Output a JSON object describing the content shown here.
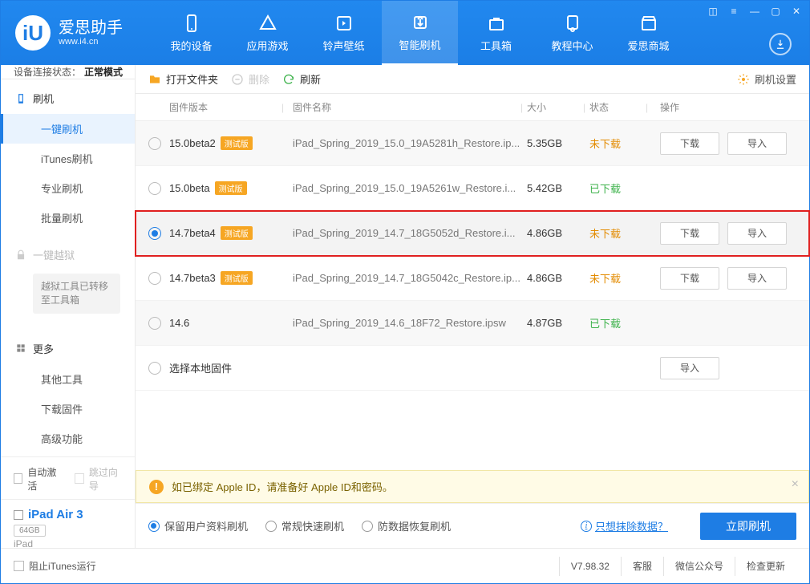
{
  "brand": {
    "name": "爱思助手",
    "url_text": "www.i4.cn",
    "logo_letter": "iU"
  },
  "nav": {
    "items": [
      {
        "label": "我的设备"
      },
      {
        "label": "应用游戏"
      },
      {
        "label": "铃声壁纸"
      },
      {
        "label": "智能刷机"
      },
      {
        "label": "工具箱"
      },
      {
        "label": "教程中心"
      },
      {
        "label": "爱思商城"
      }
    ],
    "active_index": 3
  },
  "connection": {
    "label": "设备连接状态：",
    "mode": "正常模式"
  },
  "sidebar": {
    "flash_header": "刷机",
    "items_flash": [
      "一键刷机",
      "iTunes刷机",
      "专业刷机",
      "批量刷机"
    ],
    "active_flash_index": 0,
    "jailbreak_header": "一键越狱",
    "jailbreak_note": "越狱工具已转移至工具箱",
    "more_header": "更多",
    "items_more": [
      "其他工具",
      "下载固件",
      "高级功能"
    ],
    "auto_activate": "自动激活",
    "skip_guide": "跳过向导",
    "device_name": "iPad Air 3",
    "device_storage": "64GB",
    "device_type": "iPad",
    "block_itunes": "阻止iTunes运行"
  },
  "toolbar": {
    "open_folder": "打开文件夹",
    "delete": "删除",
    "refresh": "刷新",
    "settings": "刷机设置"
  },
  "table": {
    "headers": {
      "version": "固件版本",
      "name": "固件名称",
      "size": "大小",
      "status": "状态",
      "action": "操作"
    },
    "beta_tag": "测试版",
    "download_btn": "下载",
    "import_btn": "导入",
    "status_no": "未下载",
    "status_yes": "已下载",
    "rows": [
      {
        "selected": false,
        "version": "15.0beta2",
        "beta": true,
        "name": "iPad_Spring_2019_15.0_19A5281h_Restore.ip...",
        "size": "5.35GB",
        "downloaded": false,
        "buttons": [
          "download",
          "import"
        ]
      },
      {
        "selected": false,
        "version": "15.0beta",
        "beta": true,
        "name": "iPad_Spring_2019_15.0_19A5261w_Restore.i...",
        "size": "5.42GB",
        "downloaded": true,
        "buttons": []
      },
      {
        "selected": true,
        "version": "14.7beta4",
        "beta": true,
        "name": "iPad_Spring_2019_14.7_18G5052d_Restore.i...",
        "size": "4.86GB",
        "downloaded": false,
        "buttons": [
          "download",
          "import"
        ],
        "highlight": true
      },
      {
        "selected": false,
        "version": "14.7beta3",
        "beta": true,
        "name": "iPad_Spring_2019_14.7_18G5042c_Restore.ip...",
        "size": "4.86GB",
        "downloaded": false,
        "buttons": [
          "download",
          "import"
        ]
      },
      {
        "selected": false,
        "version": "14.6",
        "beta": false,
        "name": "iPad_Spring_2019_14.6_18F72_Restore.ipsw",
        "size": "4.87GB",
        "downloaded": true,
        "buttons": []
      }
    ],
    "local_row_label": "选择本地固件"
  },
  "warning": "如已绑定 Apple ID，请准备好 Apple ID和密码。",
  "options": {
    "items": [
      "保留用户资料刷机",
      "常规快速刷机",
      "防数据恢复刷机"
    ],
    "selected_index": 0,
    "erase_link": "只想抹除数据？",
    "flash_now": "立即刷机"
  },
  "footer": {
    "version": "V7.98.32",
    "service": "客服",
    "wechat": "微信公众号",
    "update": "检查更新"
  }
}
